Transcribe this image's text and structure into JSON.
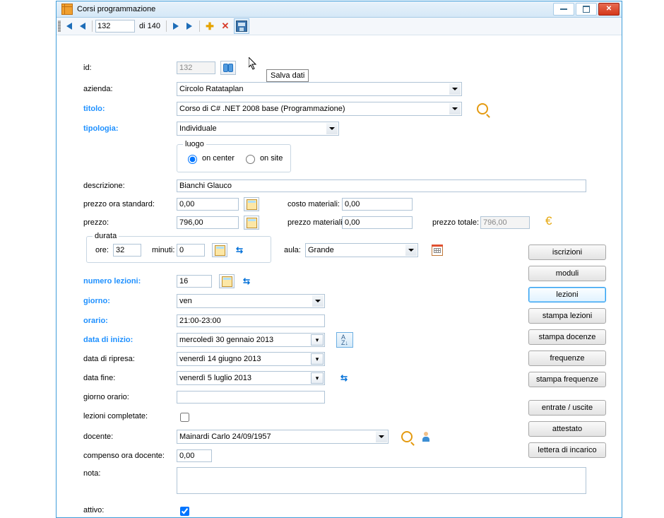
{
  "window": {
    "title": "Corsi programmazione"
  },
  "toolbar": {
    "record_current": "132",
    "record_total_text": "di 140",
    "tooltip_save": "Salva dati"
  },
  "labels": {
    "id": "id:",
    "azienda": "azienda:",
    "titolo": "titolo:",
    "tipologia": "tipologia:",
    "luogo_legend": "luogo",
    "oncenter": "on center",
    "onsite": "on site",
    "descrizione": "descrizione:",
    "prezzo_ora_standard": "prezzo ora standard:",
    "prezzo": "prezzo:",
    "costo_materiali": "costo materiali:",
    "prezzo_materiali": "prezzo materiali:",
    "prezzo_totale": "prezzo totale:",
    "durata_legend": "durata",
    "ore": "ore:",
    "minuti": "minuti:",
    "aula": "aula:",
    "numero_lezioni": "numero lezioni:",
    "giorno": "giorno:",
    "orario": "orario:",
    "data_inizio": "data di inizio:",
    "data_ripresa": "data di ripresa:",
    "data_fine": "data fine:",
    "giorno_orario": "giorno orario:",
    "lezioni_completate": "lezioni completate:",
    "docente": "docente:",
    "compenso_ora_docente": "compenso ora docente:",
    "nota": "nota:",
    "attivo": "attivo:"
  },
  "fields": {
    "id": "132",
    "azienda": "Circolo Ratataplan",
    "titolo": "Corso di C# .NET 2008 base (Programmazione)",
    "tipologia": "Individuale",
    "descrizione": "Bianchi Glauco",
    "prezzo_ora_standard": "0,00",
    "prezzo": "796,00",
    "costo_materiali": "0,00",
    "prezzo_materiali": "0,00",
    "prezzo_totale": "796,00",
    "ore": "32",
    "minuti": "0",
    "aula": "Grande",
    "numero_lezioni": "16",
    "giorno": "ven",
    "orario": "21:00-23:00",
    "data_inizio": {
      "dow": "mercoledì",
      "d": "30",
      "m": "gennaio",
      "y": "2013"
    },
    "data_ripresa": {
      "dow": "venerdì",
      "d": "14",
      "m": "giugno",
      "y": "2013"
    },
    "data_fine": {
      "dow": "venerdì",
      "d": "5",
      "m": "luglio",
      "y": "2013"
    },
    "giorno_orario": "",
    "docente": "Mainardi Carlo 24/09/1957",
    "compenso_ora_docente": "0,00",
    "nota": ""
  },
  "luogo_selected": "oncenter",
  "attivo_checked": true,
  "lezioni_completate_checked": false,
  "side_buttons": {
    "iscrizioni": "iscrizioni",
    "moduli": "moduli",
    "lezioni": "lezioni",
    "stampa_lezioni": "stampa lezioni",
    "stampa_docenze": "stampa docenze",
    "frequenze": "frequenze",
    "stampa_frequenze": "stampa frequenze",
    "entrate_uscite": "entrate / uscite",
    "attestato": "attestato",
    "lettera_incarico": "lettera di incarico"
  }
}
